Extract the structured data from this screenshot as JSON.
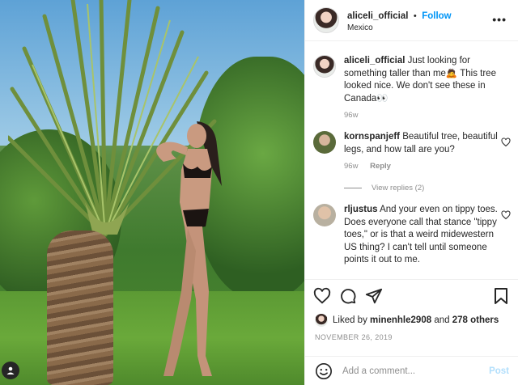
{
  "post": {
    "username": "aliceli_official",
    "follow_label": "Follow",
    "location": "Mexico",
    "more_label": "•••"
  },
  "caption": {
    "username": "aliceli_official",
    "text": "Just looking for something taller than me🙇 This tree looked nice. We don't see these in Canada👀",
    "age": "96w"
  },
  "comments": [
    {
      "username": "kornspanjeff",
      "text": "Beautiful tree, beautiful legs, and how tall are you?",
      "age": "96w",
      "reply_label": "Reply"
    },
    {
      "username": "rljustus",
      "text": "And your even on tippy toes. Does everyone call that stance \"tippy toes,\" or is that a weird midewestern US thing? I can't tell until someone points it out to me."
    }
  ],
  "view_replies_label": "View replies (2)",
  "likes": {
    "prefix": "Liked by",
    "user": "minenhle2908",
    "joiner": "and",
    "others": "278 others"
  },
  "date": "NOVEMBER 26, 2019",
  "add_comment": {
    "placeholder": "Add a comment...",
    "post_label": "Post"
  },
  "icons": [
    "heart-icon",
    "comment-icon",
    "share-icon",
    "bookmark-icon",
    "emoji-icon",
    "more-icon",
    "user-tag-icon"
  ],
  "colors": {
    "follow": "#0095f6",
    "post_disabled": "#b2dffc",
    "muted": "#8e8e8e",
    "text": "#262626"
  }
}
